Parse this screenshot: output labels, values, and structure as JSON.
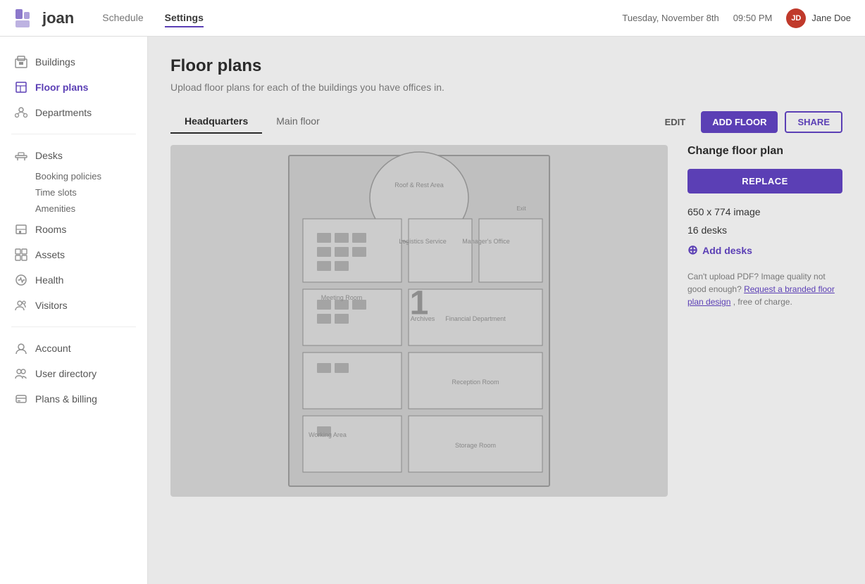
{
  "app": {
    "logo_text": "joan",
    "nav": [
      {
        "label": "Schedule",
        "active": false
      },
      {
        "label": "Settings",
        "active": true
      }
    ],
    "datetime": "Tuesday, November 8th",
    "time": "09:50 PM",
    "user": {
      "name": "Jane Doe",
      "initials": "JD"
    }
  },
  "sidebar": {
    "sections": [
      {
        "items": [
          {
            "label": "Buildings",
            "icon": "buildings",
            "active": false
          },
          {
            "label": "Floor plans",
            "icon": "floor-plans",
            "active": true
          },
          {
            "label": "Departments",
            "icon": "departments",
            "active": false
          }
        ]
      },
      {
        "items": [
          {
            "label": "Desks",
            "icon": "desks",
            "active": false,
            "subitems": [
              "Booking policies",
              "Time slots",
              "Amenities"
            ]
          },
          {
            "label": "Rooms",
            "icon": "rooms",
            "active": false
          },
          {
            "label": "Assets",
            "icon": "assets",
            "active": false
          },
          {
            "label": "Health",
            "icon": "health",
            "active": false
          },
          {
            "label": "Visitors",
            "icon": "visitors",
            "active": false
          }
        ]
      },
      {
        "items": [
          {
            "label": "Account",
            "icon": "account",
            "active": false
          },
          {
            "label": "User directory",
            "icon": "user-directory",
            "active": false
          },
          {
            "label": "Plans & billing",
            "icon": "plans-billing",
            "active": false
          }
        ]
      }
    ]
  },
  "main": {
    "page_title": "Floor plans",
    "page_subtitle": "Upload floor plans for each of the buildings you have offices in.",
    "tabs": [
      {
        "label": "Headquarters",
        "active": true
      },
      {
        "label": "Main floor",
        "active": false
      }
    ],
    "toolbar": {
      "edit_label": "EDIT",
      "add_floor_label": "ADD FLOOR",
      "share_label": "SHARE"
    },
    "floor_number": "1"
  },
  "right_panel": {
    "title": "Change floor plan",
    "replace_label": "REPLACE",
    "image_size": "650 x 774 image",
    "desks_count": "16 desks",
    "add_desks_label": "Add desks",
    "note_prefix": "Can't upload PDF? Image quality not good enough?",
    "note_link": "Request a branded floor plan design",
    "note_suffix": ", free of charge."
  }
}
